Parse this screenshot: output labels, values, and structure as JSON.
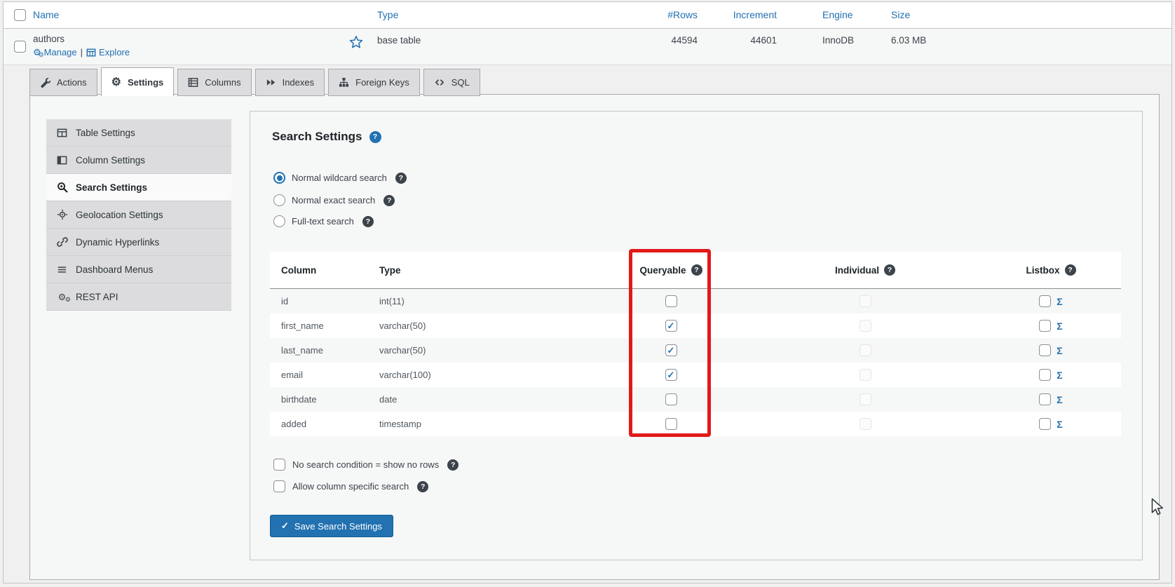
{
  "colors": {
    "accent": "#2271b1",
    "highlight": "#e01a1a"
  },
  "icons": {
    "help": "?",
    "check": "✓",
    "sigma": "Σ",
    "gear": "⚙",
    "separator": "|"
  },
  "list": {
    "headers": {
      "name": "Name",
      "type": "Type",
      "rows": "#Rows",
      "increment": "Increment",
      "engine": "Engine",
      "size": "Size"
    },
    "row": {
      "name": "authors",
      "manage": "Manage",
      "explore": "Explore",
      "type": "base table",
      "rows": "44594",
      "increment": "44601",
      "engine": "InnoDB",
      "size": "6.03 MB"
    }
  },
  "tabs": [
    {
      "label": "Actions"
    },
    {
      "label": "Settings",
      "active": true
    },
    {
      "label": "Columns"
    },
    {
      "label": "Indexes"
    },
    {
      "label": "Foreign Keys"
    },
    {
      "label": "SQL"
    }
  ],
  "sidebar": [
    {
      "label": "Table Settings"
    },
    {
      "label": "Column Settings"
    },
    {
      "label": "Search Settings",
      "active": true
    },
    {
      "label": "Geolocation Settings"
    },
    {
      "label": "Dynamic Hyperlinks"
    },
    {
      "label": "Dashboard Menus"
    },
    {
      "label": "REST API"
    }
  ],
  "search": {
    "title": "Search Settings",
    "radios": [
      {
        "label": "Normal wildcard search",
        "selected": true
      },
      {
        "label": "Normal exact search",
        "selected": false
      },
      {
        "label": "Full-text search",
        "selected": false
      }
    ],
    "table": {
      "headers": {
        "column": "Column",
        "type": "Type",
        "queryable": "Queryable",
        "individual": "Individual",
        "listbox": "Listbox"
      },
      "rows": [
        {
          "column": "id",
          "type": "int(11)",
          "queryable": false
        },
        {
          "column": "first_name",
          "type": "varchar(50)",
          "queryable": true
        },
        {
          "column": "last_name",
          "type": "varchar(50)",
          "queryable": true
        },
        {
          "column": "email",
          "type": "varchar(100)",
          "queryable": true
        },
        {
          "column": "birthdate",
          "type": "date",
          "queryable": false
        },
        {
          "column": "added",
          "type": "timestamp",
          "queryable": false
        }
      ]
    },
    "options": [
      {
        "label": "No search condition = show no rows",
        "checked": false
      },
      {
        "label": "Allow column specific search",
        "checked": false
      }
    ],
    "save_label": "Save Search Settings"
  }
}
